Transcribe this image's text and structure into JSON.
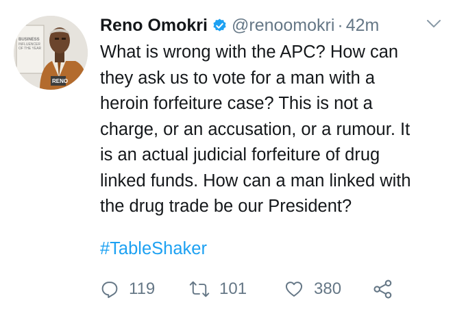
{
  "tweet": {
    "author_name": "Reno Omokri",
    "handle": "@renoomokri",
    "separator": "·",
    "time": "42m",
    "text_lines": [
      "What is wrong with the APC? How can",
      "they ask us to vote for a man with a",
      "heroin forfeiture case? This is not a",
      "charge, or an accusation, or a rumour. It",
      "is an actual judicial forfeiture of drug",
      "linked funds. How can a man linked with",
      "the drug trade be our President?"
    ],
    "hashtag": "#TableShaker",
    "replies": "119",
    "retweets": "101",
    "likes": "380"
  },
  "avatar_image": {
    "text_lines": [
      "BUSINESS",
      "INFLUENCER",
      "OF THE YEAR"
    ],
    "badge": "RENO"
  },
  "icons": {
    "verified": "verified-badge-icon",
    "caret": "chevron-down-icon",
    "reply": "reply-icon",
    "retweet": "retweet-icon",
    "like": "heart-icon",
    "share": "share-icon"
  },
  "colors": {
    "text": "#14171a",
    "secondary": "#657786",
    "link": "#1da1f2",
    "verified": "#1da1f2"
  }
}
